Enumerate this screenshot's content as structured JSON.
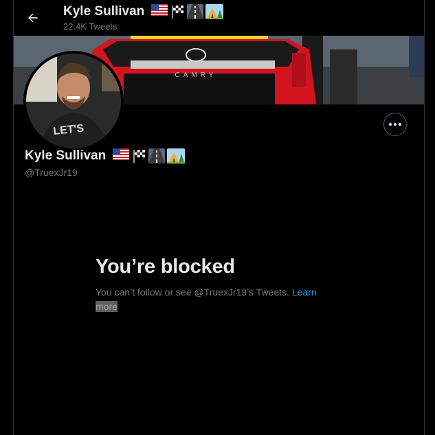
{
  "header": {
    "title": "Kyle Sullivan",
    "tweet_count": "22.4K Tweets"
  },
  "profile": {
    "display_name": "Kyle Sullivan",
    "handle": "@TruexJr19",
    "avatar_shirt_text": "LET'S"
  },
  "name_emojis": [
    "us-flag-icon",
    "checkered-flag-icon",
    "road-icon",
    "camping-icon"
  ],
  "banner": {
    "car_brand": "CAMRY"
  },
  "blocked": {
    "heading": "You’re blocked",
    "message": "You can’t follow or see @TruexJr19’s Tweets.",
    "learn": "Learn",
    "more": "more"
  },
  "colors": {
    "accent": "#1d9bf0",
    "muted": "#71767b",
    "text": "#e7e9ea",
    "background": "#000000"
  }
}
